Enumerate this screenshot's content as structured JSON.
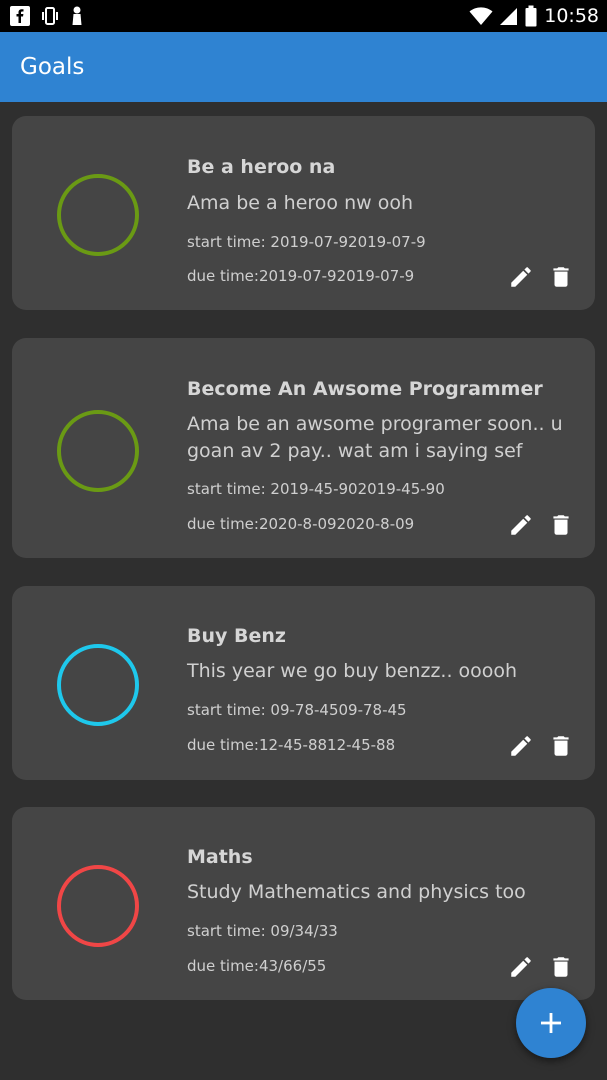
{
  "status_bar": {
    "time": "10:58",
    "icons": [
      "facebook-icon",
      "vibrate-icon",
      "notification-icon",
      "wifi-icon",
      "signal-icon",
      "battery-icon"
    ]
  },
  "app_bar": {
    "title": "Goals"
  },
  "goals": [
    {
      "title": "Be a heroo na",
      "description": "Ama be a heroo nw ooh",
      "start": "start time: 2019-07-92019-07-9",
      "due": "due time:2019-07-92019-07-9",
      "ring_color": "#6a9a14"
    },
    {
      "title": "Become An Awsome Programmer",
      "description": "Ama be an awsome programer soon.. u goan av 2 pay.. wat am i saying sef",
      "start": "start time: 2019-45-902019-45-90",
      "due": "due time:2020-8-092020-8-09",
      "ring_color": "#6a9a14"
    },
    {
      "title": "Buy Benz",
      "description": "This year we go buy benzz.. ooooh",
      "start": "start time: 09-78-4509-78-45",
      "due": "due time:12-45-8812-45-88",
      "ring_color": "#1ec8ec"
    },
    {
      "title": "Maths",
      "description": "Study Mathematics and physics too",
      "start": "start time: 09/34/33",
      "due": "due time:43/66/55",
      "ring_color": "#f04646"
    }
  ],
  "colors": {
    "accent": "#2f83d2",
    "background": "#2f2f2f",
    "card": "#454545"
  },
  "fab": {
    "icon": "plus-icon"
  }
}
